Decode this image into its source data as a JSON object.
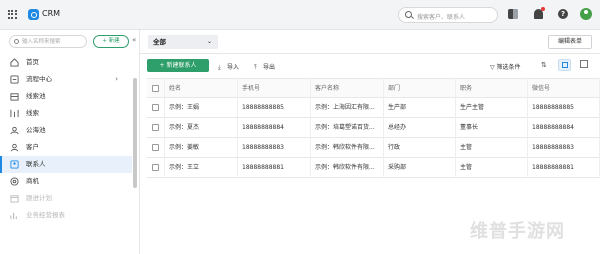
{
  "app": {
    "title": "CRM"
  },
  "topbar": {
    "search_placeholder": "搜索客户、联系人"
  },
  "sidebar": {
    "search_placeholder": "输入名称来搜索",
    "add_label": "+ 新建",
    "collapse_glyph": "«",
    "items": [
      {
        "label": "首页",
        "icon": "home-icon"
      },
      {
        "label": "流程中心",
        "icon": "workflow-icon",
        "arrow": "›"
      },
      {
        "label": "线索池",
        "icon": "lead-pool-icon"
      },
      {
        "label": "线索",
        "icon": "lead-icon"
      },
      {
        "label": "公海池",
        "icon": "public-pool-icon"
      },
      {
        "label": "客户",
        "icon": "customer-icon"
      },
      {
        "label": "联系人",
        "icon": "contact-icon",
        "active": true
      },
      {
        "label": "商机",
        "icon": "opportunity-icon"
      },
      {
        "label": "跟进计划",
        "icon": "plan-icon",
        "faded": true
      },
      {
        "label": "业务经营报表",
        "icon": "report-icon",
        "faded": true
      }
    ]
  },
  "viewbar": {
    "view_label": "全部",
    "chevron": "⌄",
    "edit_label": "编辑表单"
  },
  "toolbar": {
    "new_label": "+ 新建联系人",
    "import_label": "导入",
    "export_label": "导出",
    "filter_label": "筛选条件"
  },
  "table": {
    "headers": [
      "姓名",
      "手机号",
      "客户名称",
      "部门",
      "职务",
      "微信号"
    ],
    "rows": [
      [
        "示例：王娟",
        "18888888885",
        "示例：上海因汇有限...",
        "生产部",
        "生产主管",
        "18888888885"
      ],
      [
        "示例：夏杰",
        "18888888884",
        "示例：培葛塑诺百货...",
        "总经办",
        "董事长",
        "18888888884"
      ],
      [
        "示例：姜敏",
        "18888888883",
        "示例：韩欣软件有限...",
        "行政",
        "主管",
        "18888888883"
      ],
      [
        "示例：王立",
        "18888888881",
        "示例：韩欣软件有限...",
        "采购部",
        "主管",
        "18888888881"
      ]
    ]
  },
  "watermark": "维普手游网",
  "colors": {
    "accent_green": "#2e9e6a",
    "accent_blue": "#1e88e5",
    "active_bg": "#e8f1fb"
  }
}
